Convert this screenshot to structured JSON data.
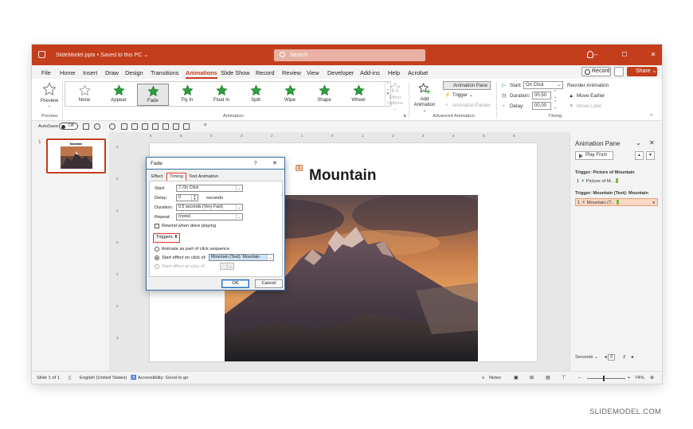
{
  "titlebar": {
    "filename": "SlideModel.pptx • Saved to this PC ⌄",
    "search_placeholder": "Search",
    "min": "–",
    "max": "☐",
    "close": "✕"
  },
  "menu": {
    "items": [
      "File",
      "Home",
      "Insert",
      "Draw",
      "Design",
      "Transitions",
      "Animations",
      "Slide Show",
      "Record",
      "Review",
      "View",
      "Developer",
      "Add-ins",
      "Help",
      "Acrobat"
    ],
    "active": "Animations",
    "record_label": "Record",
    "share_label": "Share ⌄"
  },
  "ribbon": {
    "preview_label": "Preview",
    "preview_group": "Preview",
    "animation_group": "Animation",
    "animations": [
      {
        "label": "None",
        "selected": false,
        "outline": true
      },
      {
        "label": "Appear",
        "selected": false
      },
      {
        "label": "Fade",
        "selected": true
      },
      {
        "label": "Fly In",
        "selected": false
      },
      {
        "label": "Float In",
        "selected": false
      },
      {
        "label": "Split",
        "selected": false
      },
      {
        "label": "Wipe",
        "selected": false
      },
      {
        "label": "Shape",
        "selected": false
      },
      {
        "label": "Wheel",
        "selected": false
      }
    ],
    "effect_options_1": "Effect",
    "effect_options_2": "Options ⌄",
    "add_animation_1": "Add",
    "add_animation_2": "Animation ⌄",
    "animation_pane": "Animation Pane",
    "trigger": "Trigger ⌄",
    "animation_painter": "Animation Painter",
    "advanced_group": "Advanced Animation",
    "start_label": "Start:",
    "start_value": "On Click",
    "duration_label": "Duration:",
    "duration_value": "00.50",
    "delay_label": "Delay:",
    "delay_value": "00.00",
    "reorder_label": "Reorder Animation",
    "move_earlier": "Move Earlier",
    "move_later": "Move Later",
    "timing_group": "Timing"
  },
  "qat": {
    "autosave_label": "AutoSave",
    "toggle_label": "Off"
  },
  "thumbs": {
    "number": "1",
    "title": "Mountain"
  },
  "ruler": {
    "h_marks": [
      "6",
      "5",
      "4",
      "3",
      "2",
      "1",
      "0",
      "1",
      "2",
      "3",
      "4",
      "5",
      "6"
    ],
    "v_marks": [
      "3",
      "2",
      "1",
      "0",
      "1",
      "2",
      "3"
    ]
  },
  "slide": {
    "title": "Mountain",
    "anim_tag": "1"
  },
  "pane": {
    "title": "Animation Pane",
    "play_from": "Play From",
    "trigger1_label": "Trigger: Picture of Mountain",
    "trigger1_item_num": "1",
    "trigger1_item_text": "Picture of M...",
    "trigger2_label": "Trigger: Mountain (Text): Mountain",
    "trigger2_item_num": "1",
    "trigger2_item_text": "Mountain (T...",
    "seconds_label": "Seconds ⌄",
    "seconds_from": "0",
    "seconds_to": "2"
  },
  "dialog": {
    "title": "Fade",
    "help": "?",
    "close": "✕",
    "tabs": [
      "Effect",
      "Timing",
      "Text Animation"
    ],
    "active_tab": "Timing",
    "start_label": "Start:",
    "start_value": "On Click",
    "delay_label": "Delay:",
    "delay_value": "0",
    "delay_unit": "seconds",
    "duration_label": "Duration:",
    "duration_value": "0.5 seconds (Very Fast)",
    "repeat_label": "Repeat:",
    "repeat_value": "(none)",
    "rewind_label": "Rewind when done playing",
    "triggers_label": "Triggers",
    "radio1_label": "Animate as part of click sequence",
    "radio2_label": "Start effect on click of:",
    "radio2_value": "Mountain (Text): Mountain",
    "radio3_label": "Start effect on play of:",
    "ok": "OK",
    "cancel": "Cancel"
  },
  "status": {
    "slide_of": "Slide 1 of 1",
    "language": "English (United States)",
    "accessibility": "Accessibility: Good to go",
    "notes": "Notes",
    "zoom": "74%"
  },
  "watermark": "SLIDEMODEL.COM",
  "colors": {
    "accent": "#c43e1c",
    "star_green": "#2e9e3e",
    "dialog_highlight": "#e23b2e"
  }
}
